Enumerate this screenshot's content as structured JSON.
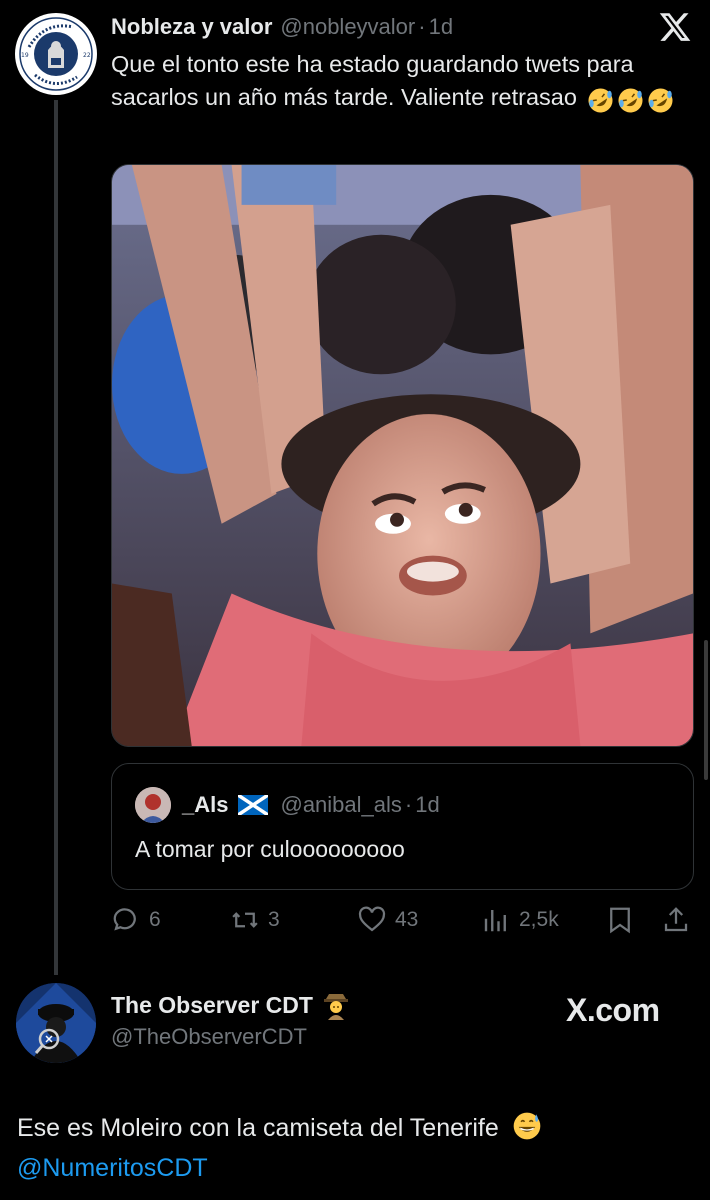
{
  "tweet": {
    "author_name": "Nobleza y valor",
    "handle": "@nobleyvalor",
    "separator": "·",
    "time": "1d",
    "text": "Que el tonto este ha estado guardando twets para sacarlos un año más tarde. Valiente retrasao",
    "text_emojis": [
      "rolling-on-floor-laughing",
      "rolling-on-floor-laughing",
      "rolling-on-floor-laughing"
    ],
    "avatar_logo_text": "REAL ZARAGOZA 90 ANIVERSARIO 1932 2022",
    "quote": {
      "author_name": "_Als",
      "flag": "scotland-flag",
      "handle": "@anibal_als",
      "separator": "·",
      "time": "1d",
      "text": "A tomar por culooooooooo"
    },
    "actions": {
      "replies": "6",
      "retweets": "3",
      "likes": "43",
      "views": "2,5k"
    }
  },
  "reply": {
    "author_name": "The Observer CDT",
    "name_emoji": "detective",
    "handle": "@TheObserverCDT",
    "watermark": "X.com",
    "text": "Ese es Moleiro con la camiseta del Tenerife",
    "text_emoji": "grinning-face-with-sweat",
    "mention": "@NumeritosCDT"
  },
  "colors": {
    "background": "#000000",
    "text_primary": "#e7e9ea",
    "text_secondary": "#71767b",
    "link": "#1d9bf0",
    "border": "#2f3336"
  }
}
